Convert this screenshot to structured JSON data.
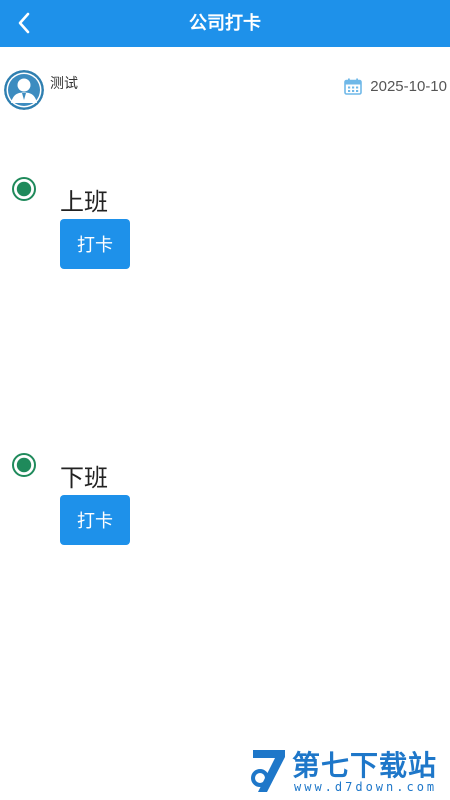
{
  "header": {
    "title": "公司打卡",
    "back_icon": "chevron-left-icon"
  },
  "user": {
    "name": "测试",
    "avatar_icon": "user-avatar-icon"
  },
  "date": {
    "value": "2025-10-10",
    "icon": "calendar-icon"
  },
  "sections": [
    {
      "label": "上班",
      "button_label": "打卡",
      "status_icon": "status-dot-icon"
    },
    {
      "label": "下班",
      "button_label": "打卡",
      "status_icon": "status-dot-icon"
    }
  ],
  "watermark": {
    "name": "第七下载站",
    "url": "www.d7down.com"
  },
  "colors": {
    "primary": "#1e91ea",
    "status_green": "#1f8a5b",
    "calendar": "#6fb8e8",
    "watermark": "#1e77c9"
  }
}
